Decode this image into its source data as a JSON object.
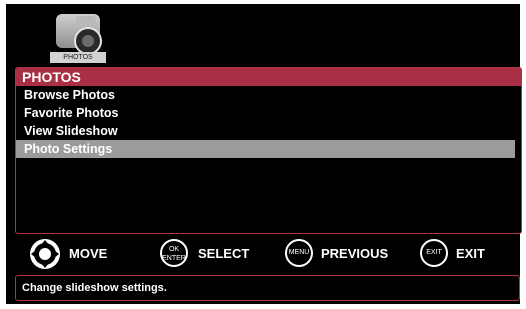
{
  "app": {
    "tile_label": "PHOTOS"
  },
  "menu": {
    "title": "PHOTOS",
    "items": [
      {
        "label": "Browse Photos",
        "selected": false
      },
      {
        "label": "Favorite Photos",
        "selected": false
      },
      {
        "label": "View Slideshow",
        "selected": false
      },
      {
        "label": "Photo Settings",
        "selected": true
      }
    ]
  },
  "controls": {
    "move_label": "MOVE",
    "ok_top": "OK",
    "ok_bottom": "ENTER",
    "select_label": "SELECT",
    "menu_button": "MENU",
    "previous_label": "PREVIOUS",
    "exit_button": "EXIT",
    "exit_label": "EXIT"
  },
  "status": {
    "text": "Change slideshow settings."
  },
  "colors": {
    "accent": "#a92f44",
    "selection": "#9b9b9b",
    "background": "#000000"
  },
  "icons": {
    "app": "camera-icon",
    "navigation": "dpad-icon"
  }
}
